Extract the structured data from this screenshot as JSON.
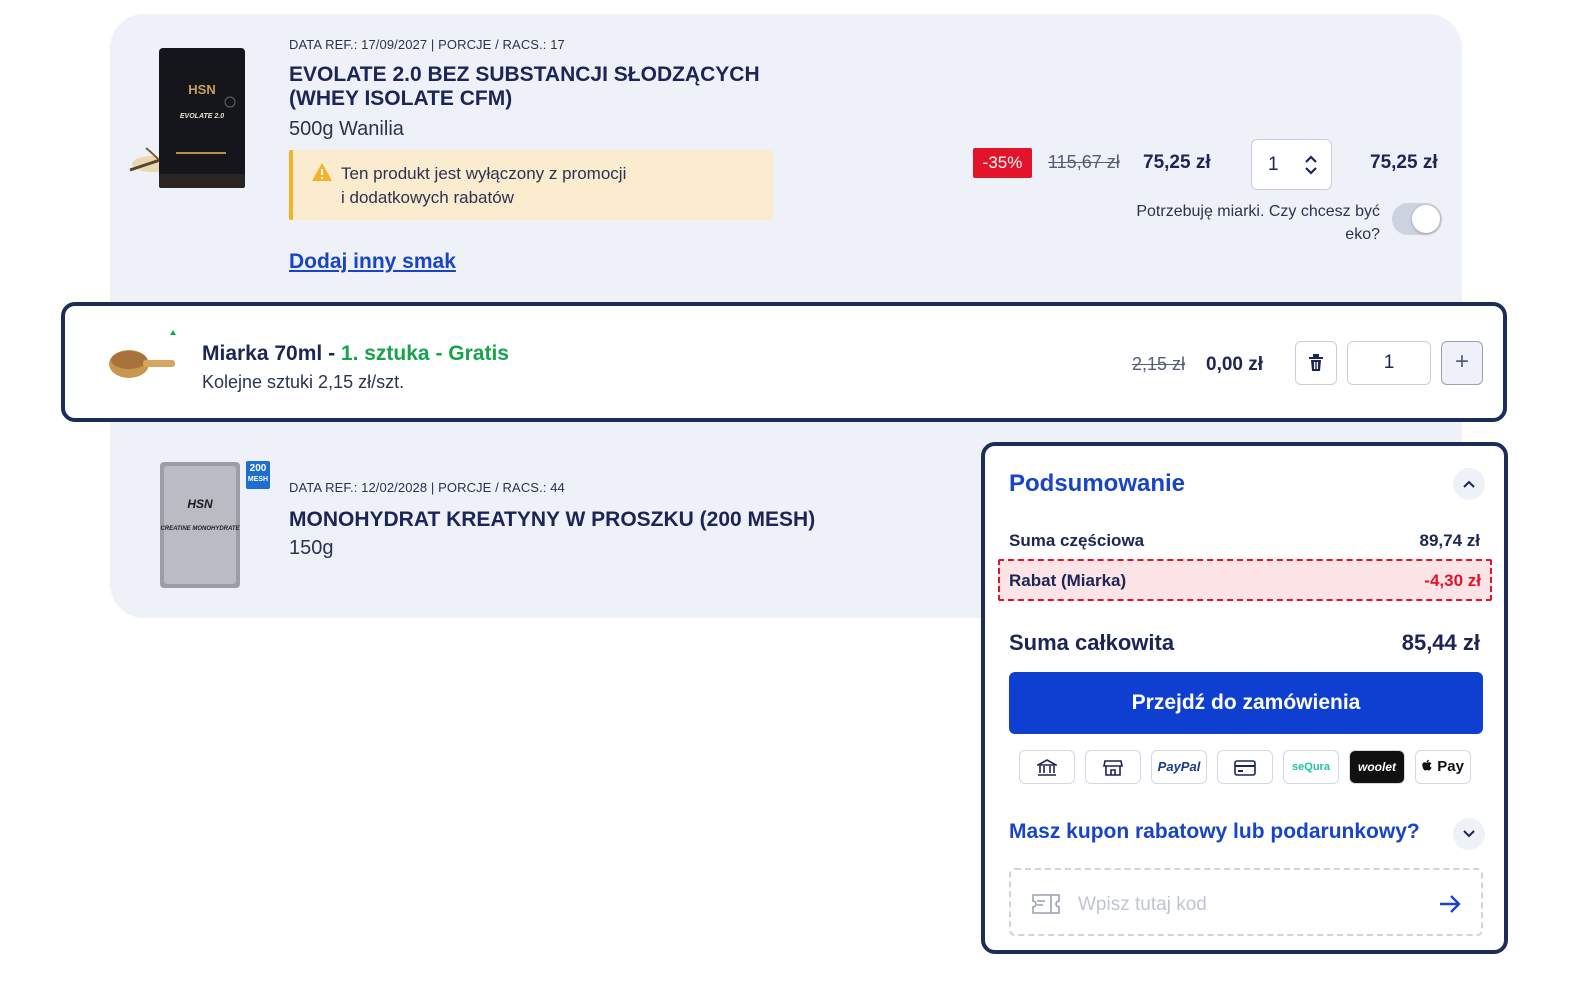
{
  "products": [
    {
      "ref": "DATA REF.: 17/09/2027 | PORCJE / RACS.: 17",
      "title": "EVOLATE 2.0  BEZ SUBSTANCJI SŁODZĄCYCH (WHEY ISOLATE CFM)",
      "variant": "500g Wanilia",
      "warning_line1": "Ten produkt jest wyłączony z promocji",
      "warning_line2": "i dodatkowych rabatów",
      "add_flavor_link": "Dodaj inny smak",
      "discount_badge": "-35%",
      "old_price": "115,67 zł",
      "price": "75,25 zł",
      "quantity": "1",
      "line_total": "75,25 zł",
      "eko_question": "Potrzebuję miarki. Czy chcesz być eko?",
      "eko_toggle_on": false,
      "image_label": "HSN",
      "image_sublabel": "EVOLATE 2.0"
    },
    {
      "ref": "DATA REF.: 12/02/2028 | PORCJE / RACS.: 44",
      "title": "MONOHYDRAT KREATYNY W PROSZKU (200 MESH)",
      "variant": "150g",
      "badge_line1": "200",
      "badge_line2": "MESH",
      "image_label": "HSN",
      "image_sublabel": "CREATINE MONOHYDRATE"
    }
  ],
  "scoop": {
    "name": "Miarka 70ml - ",
    "promo": "1. sztuka - Gratis",
    "subtitle": "Kolejne sztuki 2,15 zł/szt.",
    "old_price": "2,15 zł",
    "price": "0,00 zł",
    "quantity": "1",
    "plus": "+"
  },
  "summary": {
    "title": "Podsumowanie",
    "subtotal_label": "Suma częściowa",
    "subtotal_value": "89,74 zł",
    "discount_label": "Rabat (Miarka)",
    "discount_value": "-4,30 zł",
    "total_label": "Suma całkowita",
    "total_value": "85,44 zł",
    "checkout_label": "Przejdź do zamówienia",
    "payments": [
      "bank-icon",
      "store-icon",
      "PayPal",
      "card-icon",
      "seQura",
      "woolet",
      " Pay"
    ],
    "coupon_title": "Masz kupon rabatowy lub podarunkowy?",
    "coupon_placeholder": "Wpisz tutaj kod"
  },
  "colors": {
    "accent_blue": "#1844c8",
    "checkout_blue": "#0e3fd0",
    "navy": "#1b2556",
    "discount_red": "#e3132b",
    "promo_green": "#16a44b",
    "warning_bg": "#fbebcf"
  }
}
